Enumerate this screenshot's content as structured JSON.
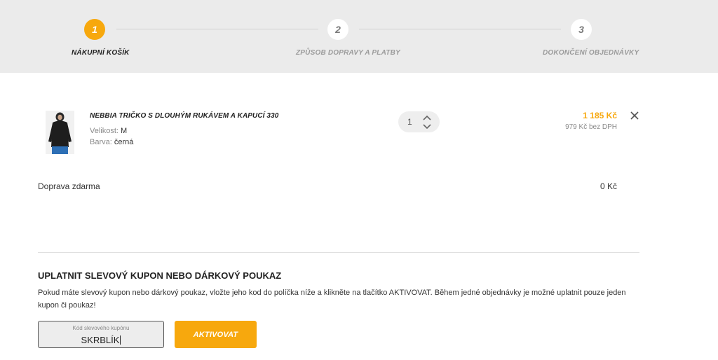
{
  "steps": [
    {
      "number": "1",
      "label": "Nákupní košík"
    },
    {
      "number": "2",
      "label": "Způsob dopravy a platby"
    },
    {
      "number": "3",
      "label": "Dokončení objednávky"
    }
  ],
  "cart": {
    "item": {
      "name": "NEBBIA TRIČKO S DLOUHÝM RUKÁVEM A KAPUCÍ 330",
      "size_label": "Velikost:",
      "size_value": "M",
      "color_label": "Barva:",
      "color_value": "černá",
      "quantity": "1",
      "price": "1 185 Kč",
      "price_net": "979 Kč bez DPH"
    },
    "shipping_label": "Doprava zdarma",
    "shipping_value": "0 Kč"
  },
  "coupon": {
    "title": "UPLATNIT SLEVOVÝ KUPON NEBO DÁRKOVÝ POUKAZ",
    "description": "Pokud máte slevový kupon nebo dárkový poukaz, vložte jeho kod do políčka níže a klikněte na tlačítko AKTIVOVAT. Během jedné objednávky je možné uplatnit pouze jeden kupon či poukaz!",
    "field_label": "Kód slevového kupónu",
    "field_value": "SKRBLÍK",
    "button_label": "Aktivovat"
  },
  "colors": {
    "accent": "#f7a80d",
    "header_bg": "#ebebeb"
  },
  "icons": {
    "remove": "close-icon",
    "qty_up": "chevron-up-icon",
    "qty_down": "chevron-down-icon"
  }
}
